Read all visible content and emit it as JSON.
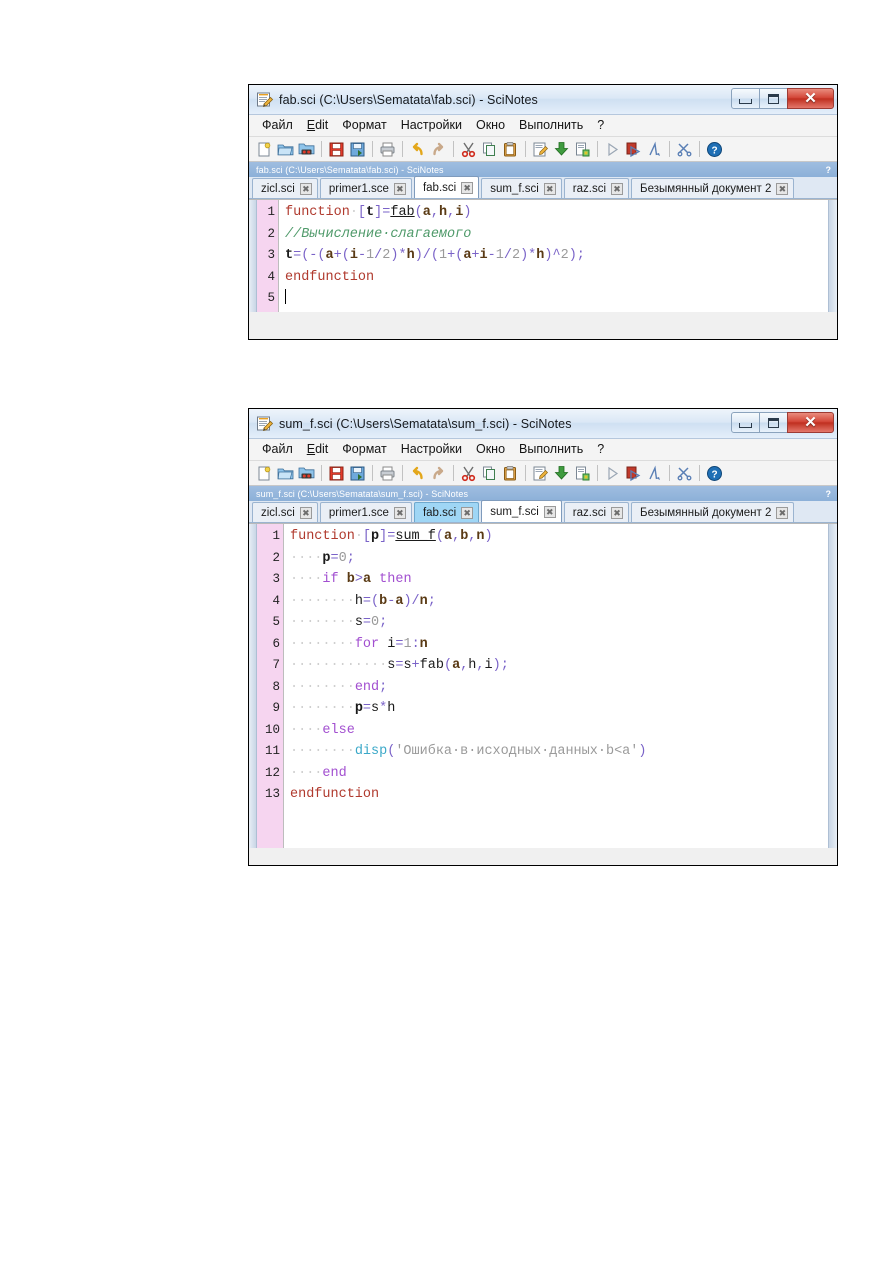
{
  "page": {
    "background": "#ffffff",
    "accent_blue": "#8cb0d8",
    "gutter_color": "#f6d5f0",
    "close_button_color": "#c02f20"
  },
  "menu": {
    "items": [
      "Файл",
      "Edit",
      "Формат",
      "Настройки",
      "Окно",
      "Выполнить",
      "?"
    ],
    "edit_mnemonic": "E"
  },
  "toolbar": {
    "icons": [
      "new-file-icon",
      "open-folder-icon",
      "open-recent-icon",
      "sep",
      "save-icon",
      "save-as-icon",
      "sep",
      "print-icon",
      "sep",
      "undo-icon",
      "redo-icon",
      "sep",
      "cut-icon",
      "copy-icon",
      "paste-icon",
      "sep",
      "execute-file-icon",
      "load-into-scilab-icon",
      "export-icon",
      "sep",
      "run-icon",
      "run-file-icon",
      "evaluate-selection-icon",
      "sep",
      "scilab-tools-icon",
      "sep",
      "help-icon"
    ]
  },
  "windows": [
    {
      "id": "fab",
      "title": "fab.sci (C:\\Users\\Sematata\\fab.sci) - SciNotes",
      "title_icon": "scinotes-icon",
      "controls": {
        "minimize": "minimize-button",
        "maximize": "maximize-button",
        "close": "close-button"
      },
      "dock_title": "fab.sci (C:\\Users\\Sematata\\fab.sci) - SciNotes",
      "dock_help": "?",
      "tabs": [
        {
          "label": "zicl.sci",
          "state": "normal",
          "closable": true
        },
        {
          "label": "primer1.sce",
          "state": "normal",
          "closable": true
        },
        {
          "label": "fab.sci",
          "state": "active",
          "closable": true
        },
        {
          "label": "sum_f.sci",
          "state": "normal",
          "closable": true
        },
        {
          "label": "raz.sci",
          "state": "normal",
          "closable": true
        },
        {
          "label": "Безымянный документ 2",
          "state": "normal",
          "closable": true
        }
      ],
      "line_numbers": [
        "1",
        "2",
        "3",
        "4",
        "5"
      ],
      "code_lines": [
        "function [t]=fab(a,h,i)",
        "//Вычисление слагаемого",
        "t=(-(a+(i-1/2)*h)/(1+(a+i-1/2)*h)^2);",
        "endfunction",
        ""
      ]
    },
    {
      "id": "sum_f",
      "title": "sum_f.sci (C:\\Users\\Sematata\\sum_f.sci) - SciNotes",
      "title_icon": "scinotes-icon",
      "controls": {
        "minimize": "minimize-button",
        "maximize": "maximize-button",
        "close": "close-button"
      },
      "dock_title": "sum_f.sci (C:\\Users\\Sematata\\sum_f.sci) - SciNotes",
      "dock_help": "?",
      "tabs": [
        {
          "label": "zicl.sci",
          "state": "normal",
          "closable": true
        },
        {
          "label": "primer1.sce",
          "state": "normal",
          "closable": true
        },
        {
          "label": "fab.sci",
          "state": "hover",
          "closable": true
        },
        {
          "label": "sum_f.sci",
          "state": "active",
          "closable": true
        },
        {
          "label": "raz.sci",
          "state": "normal",
          "closable": true
        },
        {
          "label": "Безымянный документ 2",
          "state": "normal",
          "closable": true
        }
      ],
      "line_numbers": [
        "1",
        "2",
        "3",
        "4",
        "5",
        "6",
        "7",
        "8",
        "9",
        "10",
        "11",
        "12",
        "13"
      ],
      "code_lines": [
        "function [p]=sum_f(a,b,n)",
        "    p=0;",
        "    if b>a then",
        "        h=(b-a)/n;",
        "        s=0;",
        "        for i=1:n",
        "            s=s+fab(a,h,i);",
        "        end;",
        "        p=s*h",
        "    else",
        "        disp('Ошибка в исходных данных b<a')",
        "    end",
        "endfunction"
      ]
    }
  ]
}
